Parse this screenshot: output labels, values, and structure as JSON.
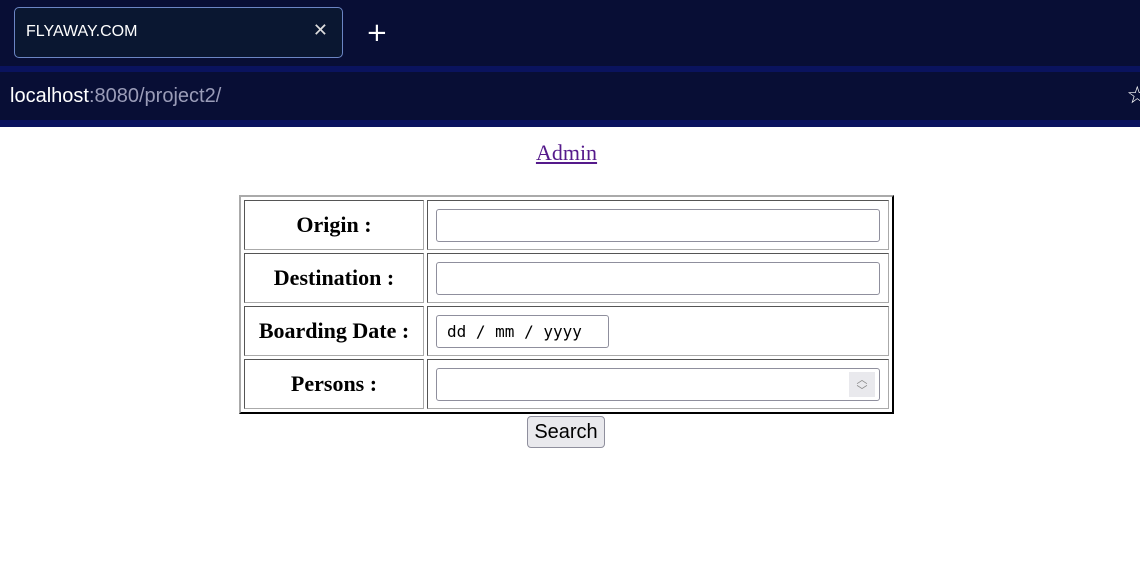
{
  "browser": {
    "tab_title": "FLYAWAY.COM",
    "url_host": "localhost",
    "url_rest": ":8080/project2/"
  },
  "page": {
    "admin_link": "Admin",
    "fields": [
      {
        "label": "Origin :",
        "value": ""
      },
      {
        "label": "Destination :",
        "value": ""
      },
      {
        "label": "Boarding Date :",
        "placeholder": "dd / mm / yyyy"
      },
      {
        "label": "Persons :",
        "value": ""
      }
    ],
    "search_label": "Search"
  }
}
